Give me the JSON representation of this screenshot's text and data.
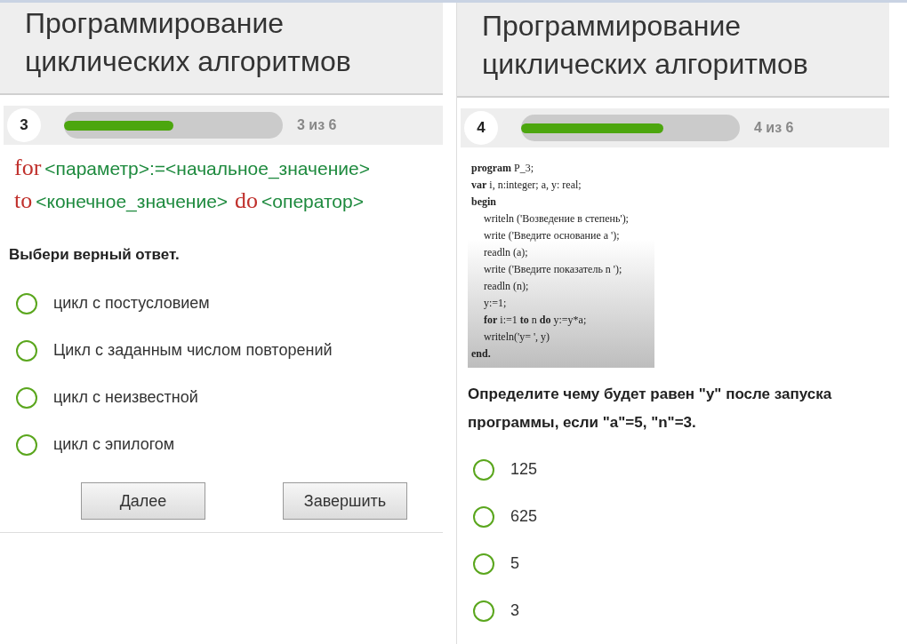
{
  "panels": [
    {
      "title": "Программирование циклических алгоритмов",
      "question_number": "3",
      "progress": {
        "level": 0.5,
        "label": "3 из 6"
      },
      "content": {
        "kind": "formula",
        "lines": [
          [
            {
              "text": "for",
              "kind": "keyword"
            },
            {
              "text": "<параметр>:=<начальное_значение>",
              "kind": "param"
            }
          ],
          [
            {
              "text": "to",
              "kind": "keyword"
            },
            {
              "text": "<конечное_значение>",
              "kind": "param"
            },
            {
              "text": "do",
              "kind": "keyword"
            },
            {
              "text": "<оператор>",
              "kind": "param"
            }
          ]
        ]
      },
      "prompt": "Выбери верный ответ.",
      "options": [
        {
          "label": "цикл с постусловием",
          "selected": false
        },
        {
          "label": "Цикл с заданным числом повторений",
          "selected": false
        },
        {
          "label": "цикл с неизвестной",
          "selected": false
        },
        {
          "label": "цикл с эпилогом",
          "selected": false
        }
      ],
      "buttons": [
        "Далее",
        "Завершить"
      ]
    },
    {
      "title": "Программирование циклических алгоритмов",
      "question_number": "4",
      "progress": {
        "level": 0.65,
        "label": "4 из 6"
      },
      "content": {
        "kind": "code",
        "lines": [
          {
            "text": "**program** P_3;"
          },
          {
            "text": "**var** i, n:integer; a, y: real;"
          },
          {
            "text": "**begin**",
            "children": [
              {
                "text": "writeln ('Возведение в степень');"
              },
              {
                "text": "write ('Введите основание a ');"
              },
              {
                "text": "readln (a);"
              },
              {
                "text": "write ('Введите показатель n ');"
              },
              {
                "text": "readln (n);"
              },
              {
                "text": "y:=1;"
              },
              {
                "text": "**for** i:=1 **to** n **do** y:=y*a;"
              },
              {
                "text": "writeln('y= ', y)"
              }
            ]
          },
          {
            "text": "**end.**"
          }
        ]
      },
      "prompt": "Определите чему будет равен \"y\" после запуска программы, если \"a\"=5, \"n\"=3.",
      "options": [
        {
          "label": "125",
          "selected": false
        },
        {
          "label": "625",
          "selected": false
        },
        {
          "label": "5",
          "selected": false
        },
        {
          "label": "3",
          "selected": false
        }
      ]
    }
  ]
}
